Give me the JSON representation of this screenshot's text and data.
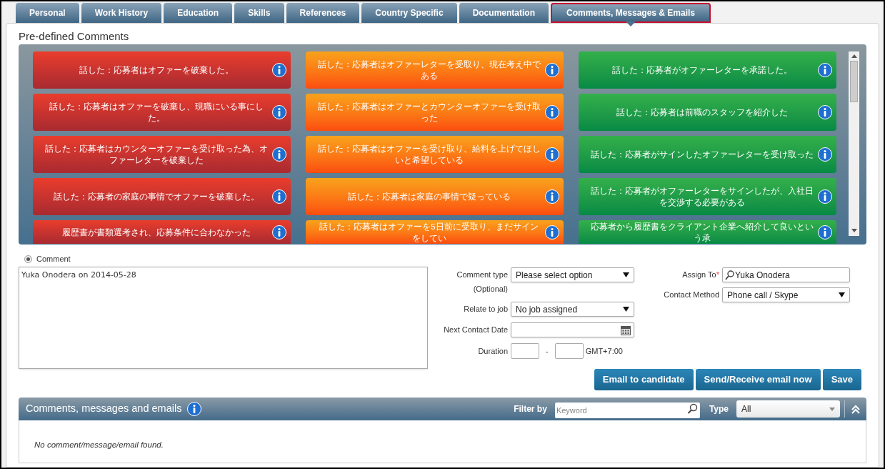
{
  "tabs": [
    {
      "label": "Personal",
      "selected": false
    },
    {
      "label": "Work History",
      "selected": false
    },
    {
      "label": "Education",
      "selected": false
    },
    {
      "label": "Skills",
      "selected": false
    },
    {
      "label": "References",
      "selected": false
    },
    {
      "label": "Country Specific",
      "selected": false
    },
    {
      "label": "Documentation",
      "selected": false
    },
    {
      "label": "Comments, Messages & Emails",
      "selected": true
    }
  ],
  "predefined": {
    "title": "Pre-defined Comments",
    "cards": [
      {
        "text": "話した：応募者はオファーを破棄した。",
        "kind": "red"
      },
      {
        "text": "話した：応募者はオファーレターを受取り、現在考え中である",
        "kind": "orange"
      },
      {
        "text": "話した：応募者がオファーレターを承諾した。",
        "kind": "green"
      },
      {
        "text": "話した：応募者はオファーを破棄し、現職にいる事にした。",
        "kind": "red"
      },
      {
        "text": "話した：応募者はオファーとカウンターオファーを受け取った",
        "kind": "orange"
      },
      {
        "text": "話した：応募者は前職のスタッフを紹介した",
        "kind": "green"
      },
      {
        "text": "話した：応募者はカウンターオファーを受け取った為、オファーレターを破棄した",
        "kind": "red"
      },
      {
        "text": "話した：応募者はオファーを受け取り、給料を上げてほしいと希望している",
        "kind": "orange"
      },
      {
        "text": "話した：応募者がサインしたオファーレターを受け取った",
        "kind": "green"
      },
      {
        "text": "話した：応募者の家庭の事情でオファーを破棄した。",
        "kind": "red"
      },
      {
        "text": "話した：応募者は家庭の事情で疑っている",
        "kind": "orange"
      },
      {
        "text": "話した：応募者がオファーレターをサインしたが、入社日を交渉する必要がある",
        "kind": "green"
      },
      {
        "text": "履歴書が書類選考され、応募条件に合わなかった",
        "kind": "red"
      },
      {
        "text": "話した：応募者はオファーを5日前に受取り、まだサインをしてい",
        "kind": "orange"
      },
      {
        "text": "応募者から履歴書をクライアント企業へ紹介して良いという承",
        "kind": "green"
      }
    ]
  },
  "comment_radio": {
    "label": "Comment",
    "selected": true
  },
  "comment_text": "Yuka Onodera on 2014-05-28",
  "form": {
    "comment_type": {
      "label": "Comment type",
      "sub": "(Optional)",
      "value": "Please select option"
    },
    "relate_to_job": {
      "label": "Relate to job",
      "value": "No job assigned"
    },
    "next_contact_date": {
      "label": "Next Contact Date"
    },
    "duration": {
      "label": "Duration",
      "separator": "-",
      "timezone": "GMT+7:00"
    },
    "assign_to": {
      "label": "Assign To",
      "required": "*",
      "value": "Yuka Onodera"
    },
    "contact_method": {
      "label": "Contact Method",
      "value": "Phone call / Skype"
    }
  },
  "buttons": [
    "Email to candidate",
    "Send/Receive email now",
    "Save"
  ],
  "list_section": {
    "title": "Comments, messages and emails",
    "filter_label": "Filter by",
    "keyword_placeholder": "Keyword",
    "type_label": "Type",
    "type_value": "All",
    "empty_text": "No comment/message/email found."
  }
}
